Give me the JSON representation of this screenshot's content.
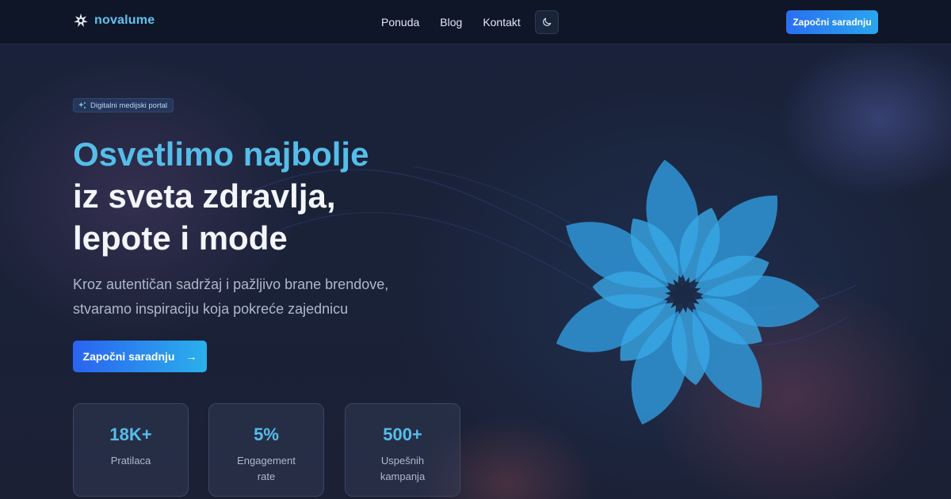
{
  "brand": {
    "name": "novalume"
  },
  "nav": {
    "links": [
      "Ponuda",
      "Blog",
      "Kontakt"
    ],
    "theme_icon": "moon-icon",
    "cta_label": "Započni saradnju"
  },
  "hero": {
    "badge": "Digitalni medijski portal",
    "headline_line1": "Osvetlimo najbolje",
    "headline_line2": "iz sveta zdravlja,",
    "headline_line3": "lepote i mode",
    "subtitle": "Kroz autentičan sadržaj i pažljivo brane brendove, stvaramo inspiraciju koja pokreće zajednicu",
    "cta_label": "Započni saradnju",
    "cta_icon": "arrow-right-icon"
  },
  "stats": [
    {
      "value": "18K+",
      "label": "Pratilaca"
    },
    {
      "value": "5%",
      "label": "Engagement rate"
    },
    {
      "value": "500+",
      "label": "Uspešnih kampanja"
    }
  ],
  "colors": {
    "accent": "#56bde9",
    "button_start": "#2a63f0",
    "button_end": "#2ab0ec",
    "background": "#1a2238",
    "nav_background": "#0f1628"
  }
}
